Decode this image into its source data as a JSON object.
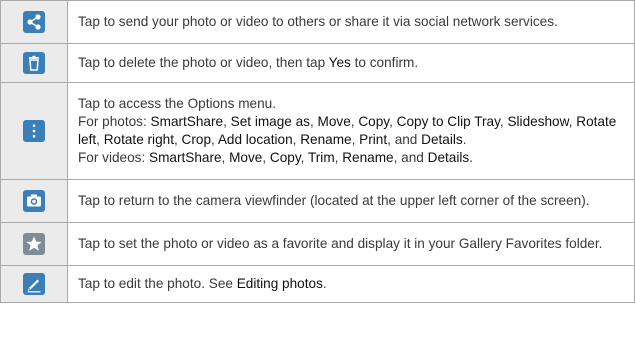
{
  "colors": {
    "icon_bg_blue": "#3b7fb8",
    "icon_bg_gray": "#7f8c97",
    "cell_bg": "#ebebeb",
    "border": "#a9a9a9"
  },
  "rows": [
    {
      "icon": "share-icon",
      "text": "Tap to send your photo or video to others or share it via social network services."
    },
    {
      "icon": "trash-icon",
      "text_before": "Tap to delete the photo or video, then tap ",
      "bold": "Yes",
      "text_after": " to confirm."
    },
    {
      "icon": "overflow-menu-icon",
      "intro": "Tap to access the Options menu.",
      "photos_prefix": "For photos: ",
      "photos_items": [
        "SmartShare",
        "Set image as",
        "Move",
        "Copy",
        "Copy to Clip Tray",
        "Slideshow",
        "Rotate left",
        "Rotate right",
        "Crop",
        "Add location",
        "Rename",
        "Print"
      ],
      "photos_last": "Details",
      "videos_prefix": "For videos: ",
      "videos_items": [
        "SmartShare",
        "Move",
        "Copy",
        "Trim",
        "Rename"
      ],
      "videos_last": "Details",
      "separator": ", ",
      "and_word": "and ",
      "period": "."
    },
    {
      "icon": "camera-icon",
      "text": "Tap to return to the camera viewfinder (located at the upper left corner of the screen)."
    },
    {
      "icon": "star-icon",
      "text": "Tap to set the photo or video as a favorite and display it in your Gallery Favorites folder."
    },
    {
      "icon": "edit-pencil-icon",
      "text_before": "Tap to edit the photo. See ",
      "bold": "Editing photos",
      "text_after": "."
    }
  ]
}
